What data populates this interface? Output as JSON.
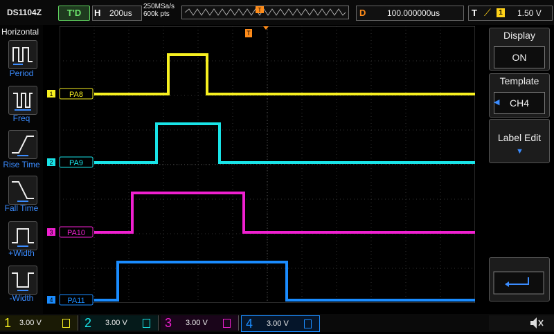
{
  "top": {
    "model": "DS1104Z",
    "trig_state": "T'D",
    "h_label": "H",
    "timebase": "200us",
    "sample_rate": "250MSa/s",
    "mem_depth": "600k pts",
    "delay_label": "D",
    "delay_value": "100.000000us",
    "trig_label": "T",
    "trig_source": "1",
    "trig_level": "1.50 V"
  },
  "left_menu": {
    "title": "Horizontal",
    "items": [
      {
        "label": "Period",
        "icon": "period-icon"
      },
      {
        "label": "Freq",
        "icon": "freq-icon"
      },
      {
        "label": "Rise Time",
        "icon": "rise-time-icon"
      },
      {
        "label": "Fall Time",
        "icon": "fall-time-icon"
      },
      {
        "label": "+Width",
        "icon": "pos-width-icon"
      },
      {
        "label": "-Width",
        "icon": "neg-width-icon"
      }
    ]
  },
  "right_menu": {
    "display_title": "Display",
    "display_value": "ON",
    "template_title": "Template",
    "template_value": "CH4",
    "label_edit": "Label Edit"
  },
  "channels": [
    {
      "num": "1",
      "label": "PA8",
      "color": "#f7f020",
      "high_us": [
        428,
        652
      ],
      "high_level": "3 V"
    },
    {
      "num": "2",
      "label": "PA9",
      "color": "#19e4e8",
      "high_us": [
        358,
        722
      ]
    },
    {
      "num": "3",
      "label": "PA10",
      "color": "#f020d0",
      "high_us": [
        218,
        862
      ]
    },
    {
      "num": "4",
      "label": "PA11",
      "color": "#1a8cff",
      "high_us": [
        136,
        1112
      ]
    }
  ],
  "bottom": {
    "ch1_num": "1",
    "ch1_scale": "3.00 V",
    "ch2_num": "2",
    "ch2_scale": "3.00 V",
    "ch3_num": "3",
    "ch3_scale": "3.00 V",
    "ch4_num": "4",
    "ch4_scale": "3.00 V"
  },
  "colors": {
    "grid": "#3a3a3a",
    "accent_orange": "#ff8c1a",
    "menu_blue": "#3b8cff"
  }
}
